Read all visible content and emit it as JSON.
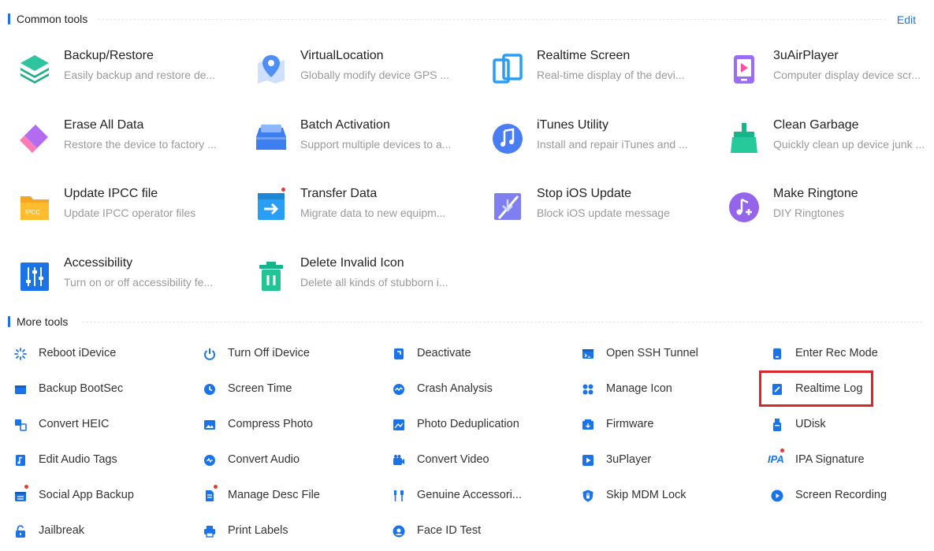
{
  "common_tools": {
    "title": "Common tools",
    "edit_label": "Edit",
    "items": [
      {
        "name": "Backup/Restore",
        "desc": "Easily backup and restore de...",
        "icon": "layers-icon"
      },
      {
        "name": "VirtualLocation",
        "desc": "Globally modify device GPS ...",
        "icon": "location-pin-icon"
      },
      {
        "name": "Realtime Screen",
        "desc": "Real-time display of the devi...",
        "icon": "screen-mirror-icon"
      },
      {
        "name": "3uAirPlayer",
        "desc": "Computer display device scr...",
        "icon": "airplayer-icon"
      },
      {
        "name": "Erase All Data",
        "desc": "Restore the device to factory ...",
        "icon": "eraser-icon"
      },
      {
        "name": "Batch Activation",
        "desc": "Support multiple devices to a...",
        "icon": "batch-activation-icon"
      },
      {
        "name": "iTunes Utility",
        "desc": "Install and repair iTunes and ...",
        "icon": "music-note-icon"
      },
      {
        "name": "Clean Garbage",
        "desc": "Quickly clean up device junk ...",
        "icon": "broom-icon"
      },
      {
        "name": "Update IPCC file",
        "desc": "Update IPCC operator files",
        "icon": "ipcc-folder-icon"
      },
      {
        "name": "Transfer Data",
        "desc": "Migrate data to new equipm...",
        "icon": "transfer-icon"
      },
      {
        "name": "Stop iOS Update",
        "desc": "Block iOS update message",
        "icon": "stop-update-icon"
      },
      {
        "name": "Make Ringtone",
        "desc": "DIY Ringtones",
        "icon": "ringtone-icon"
      },
      {
        "name": "Accessibility",
        "desc": "Turn on or off accessibility fe...",
        "icon": "sliders-icon"
      },
      {
        "name": "Delete Invalid Icon",
        "desc": "Delete all kinds of stubborn i...",
        "icon": "trash-icon"
      }
    ]
  },
  "more_tools": {
    "title": "More tools",
    "items": [
      {
        "label": "Reboot iDevice",
        "icon": "reboot-icon"
      },
      {
        "label": "Turn Off iDevice",
        "icon": "power-icon"
      },
      {
        "label": "Deactivate",
        "icon": "deactivate-icon"
      },
      {
        "label": "Open SSH Tunnel",
        "icon": "terminal-icon"
      },
      {
        "label": "Enter Rec Mode",
        "icon": "phone-icon"
      },
      {
        "label": "Backup BootSec",
        "icon": "backup-bootsec-icon"
      },
      {
        "label": "Screen Time",
        "icon": "clock-icon"
      },
      {
        "label": "Crash Analysis",
        "icon": "crash-analysis-icon"
      },
      {
        "label": "Manage Icon",
        "icon": "grid-icon"
      },
      {
        "label": "Realtime Log",
        "icon": "log-icon"
      },
      {
        "label": "Convert HEIC",
        "icon": "convert-heic-icon"
      },
      {
        "label": "Compress Photo",
        "icon": "image-icon"
      },
      {
        "label": "Photo Deduplication",
        "icon": "photo-dedup-icon"
      },
      {
        "label": "Firmware",
        "icon": "firmware-icon"
      },
      {
        "label": "UDisk",
        "icon": "udisk-icon"
      },
      {
        "label": "Edit Audio Tags",
        "icon": "audio-tag-icon"
      },
      {
        "label": "Convert Audio",
        "icon": "convert-audio-icon"
      },
      {
        "label": "Convert Video",
        "icon": "video-icon"
      },
      {
        "label": "3uPlayer",
        "icon": "play-icon"
      },
      {
        "label": "IPA Signature",
        "icon": "ipa-icon"
      },
      {
        "label": "Social App Backup",
        "icon": "social-backup-icon"
      },
      {
        "label": "Manage Desc File",
        "icon": "desc-file-icon"
      },
      {
        "label": "Genuine Accessori...",
        "icon": "accessories-icon"
      },
      {
        "label": "Skip MDM Lock",
        "icon": "shield-icon"
      },
      {
        "label": "Screen Recording",
        "icon": "record-icon"
      },
      {
        "label": "Jailbreak",
        "icon": "unlock-icon"
      },
      {
        "label": "Print Labels",
        "icon": "printer-icon"
      },
      {
        "label": "Face ID Test",
        "icon": "face-id-icon"
      }
    ],
    "ipa_icon_text": "IPA"
  },
  "colors": {
    "accent": "#1a73e8",
    "highlight": "#d9262c",
    "notify": "#e53935"
  }
}
